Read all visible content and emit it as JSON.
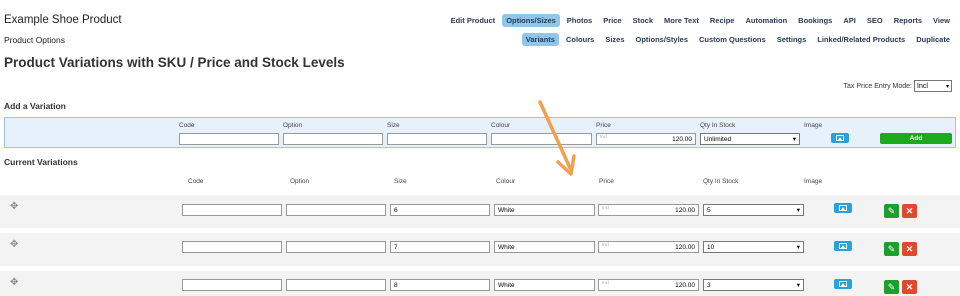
{
  "header": {
    "product_title": "Example Shoe Product",
    "sub_title": "Product Options",
    "main_title": "Product Variations with SKU / Price and Stock Levels"
  },
  "tabs_row1": [
    {
      "label": "Edit Product",
      "active": false
    },
    {
      "label": "Options/Sizes",
      "active": true
    },
    {
      "label": "Photos",
      "active": false
    },
    {
      "label": "Price",
      "active": false
    },
    {
      "label": "Stock",
      "active": false
    },
    {
      "label": "More Text",
      "active": false
    },
    {
      "label": "Recipe",
      "active": false
    },
    {
      "label": "Automation",
      "active": false
    },
    {
      "label": "Bookings",
      "active": false
    },
    {
      "label": "API",
      "active": false
    },
    {
      "label": "SEO",
      "active": false
    },
    {
      "label": "Reports",
      "active": false
    },
    {
      "label": "View",
      "active": false
    }
  ],
  "tabs_row2": [
    {
      "label": "Variants",
      "active": true
    },
    {
      "label": "Colours",
      "active": false
    },
    {
      "label": "Sizes",
      "active": false
    },
    {
      "label": "Options/Styles",
      "active": false
    },
    {
      "label": "Custom Questions",
      "active": false
    },
    {
      "label": "Settings",
      "active": false
    },
    {
      "label": "Linked/Related Products",
      "active": false
    },
    {
      "label": "Duplicate",
      "active": false
    }
  ],
  "tax_mode": {
    "label": "Tax Price Entry Mode:",
    "value": "Incl"
  },
  "add_variation": {
    "heading": "Add a Variation",
    "labels": {
      "code": "Code",
      "option": "Option",
      "size": "Size",
      "colour": "Colour",
      "price": "Price",
      "qty": "Qty In Stock",
      "image": "Image"
    },
    "values": {
      "code": "",
      "option": "",
      "size": "",
      "colour": "",
      "price": "120.00",
      "price_placeholder": "Incl",
      "qty": "Unlimited"
    },
    "add_label": "Add"
  },
  "current_variations": {
    "heading": "Current Variations",
    "headers": {
      "code": "Code",
      "option": "Option",
      "size": "Size",
      "colour": "Colour",
      "price": "Price",
      "qty": "Qty In Stock",
      "image": "Image"
    },
    "rows": [
      {
        "code": "",
        "option": "",
        "size": "6",
        "colour": "White",
        "price": "120.00",
        "price_placeholder": "Incl",
        "qty": "5"
      },
      {
        "code": "",
        "option": "",
        "size": "7",
        "colour": "White",
        "price": "120.00",
        "price_placeholder": "Incl",
        "qty": "10"
      },
      {
        "code": "",
        "option": "",
        "size": "8",
        "colour": "White",
        "price": "120.00",
        "price_placeholder": "Incl",
        "qty": "3"
      }
    ]
  },
  "icons": {
    "move": "move-icon",
    "image": "image-icon",
    "edit": "pencil-icon",
    "delete": "close-icon",
    "annotation": "arrow-annotation"
  },
  "colors": {
    "active_tab": "#8fc6ea",
    "add_box_bg": "#e6f1fb",
    "add_button": "#1caa1c",
    "image_button": "#27a3d9",
    "edit_button": "#1e9e2a",
    "delete_button": "#e2472f",
    "arrow": "#f0a050"
  }
}
